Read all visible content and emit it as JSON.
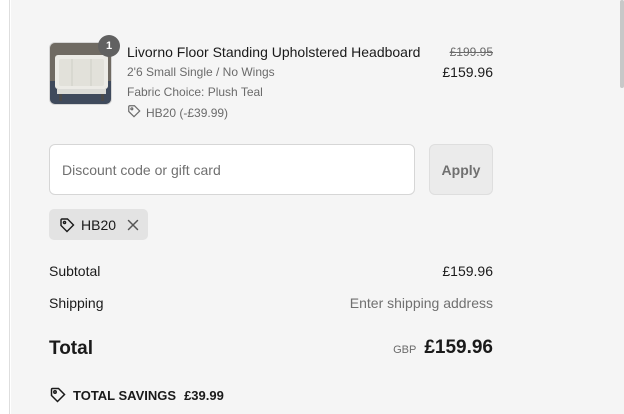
{
  "line_item": {
    "quantity": "1",
    "title": "Livorno Floor Standing Upholstered Headboard",
    "variant": "2'6 Small Single / No Wings",
    "fabric": "Fabric Choice: Plush Teal",
    "discount_line": "HB20 (-£39.99)",
    "original_price": "£199.95",
    "price": "£159.96",
    "image_icon": "headboard-product-thumbnail"
  },
  "discount": {
    "placeholder": "Discount code or gift card",
    "value": "",
    "apply_label": "Apply"
  },
  "applied_code": {
    "code": "HB20",
    "icon": "tag-icon",
    "remove_icon": "close-icon"
  },
  "summary": {
    "subtotal_label": "Subtotal",
    "subtotal_value": "£159.96",
    "shipping_label": "Shipping",
    "shipping_value": "Enter shipping address",
    "total_label": "Total",
    "currency": "GBP",
    "total_value": "£159.96",
    "savings_label": "TOTAL SAVINGS",
    "savings_value": "£39.99"
  },
  "colors": {
    "panel_bg": "#f5f5f5",
    "badge_bg": "#616161",
    "chip_bg": "#e3e3e3",
    "muted_text": "#6b6b6b"
  }
}
